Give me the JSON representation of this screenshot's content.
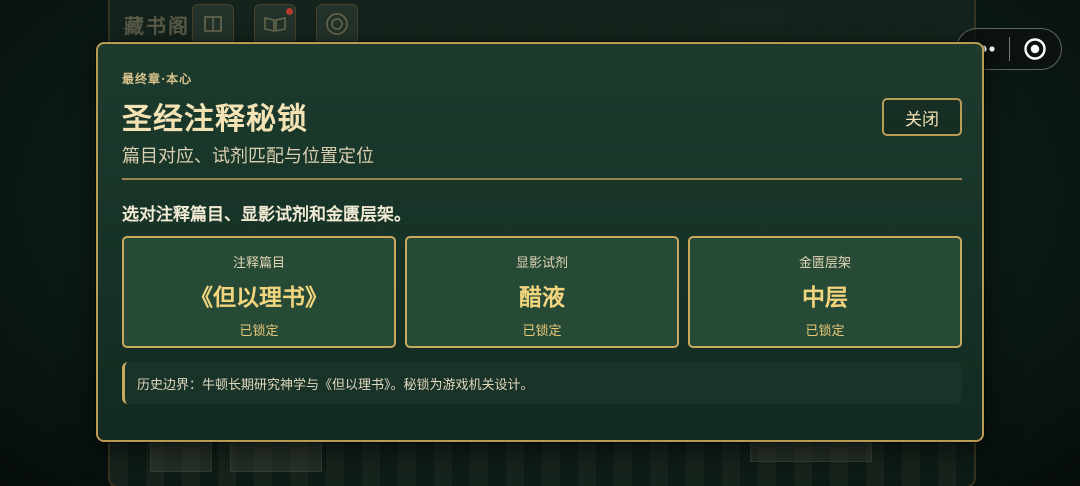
{
  "background": {
    "app_title": "藏书阁"
  },
  "capsule": {
    "more_icon": "more-dots-icon",
    "close_icon": "target-circle-icon"
  },
  "modal": {
    "eyebrow": "最终章·本心",
    "title": "圣经注释秘锁",
    "subtitle": "篇目对应、试剂匹配与位置定位",
    "close_label": "关闭",
    "instruction": "选对注释篇目、显影试剂和金匮层架。",
    "cards": [
      {
        "label": "注释篇目",
        "value": "《但以理书》",
        "status": "已锁定"
      },
      {
        "label": "显影试剂",
        "value": "醋液",
        "status": "已锁定"
      },
      {
        "label": "金匮层架",
        "value": "中层",
        "status": "已锁定"
      }
    ],
    "note": "历史边界：牛顿长期研究神学与《但以理书》。秘锁为游戏机关设计。"
  },
  "colors": {
    "accent_gold": "#c9a962",
    "panel_green": "#1c3b2d",
    "card_green": "#274a37",
    "value_gold": "#f3d57e"
  }
}
